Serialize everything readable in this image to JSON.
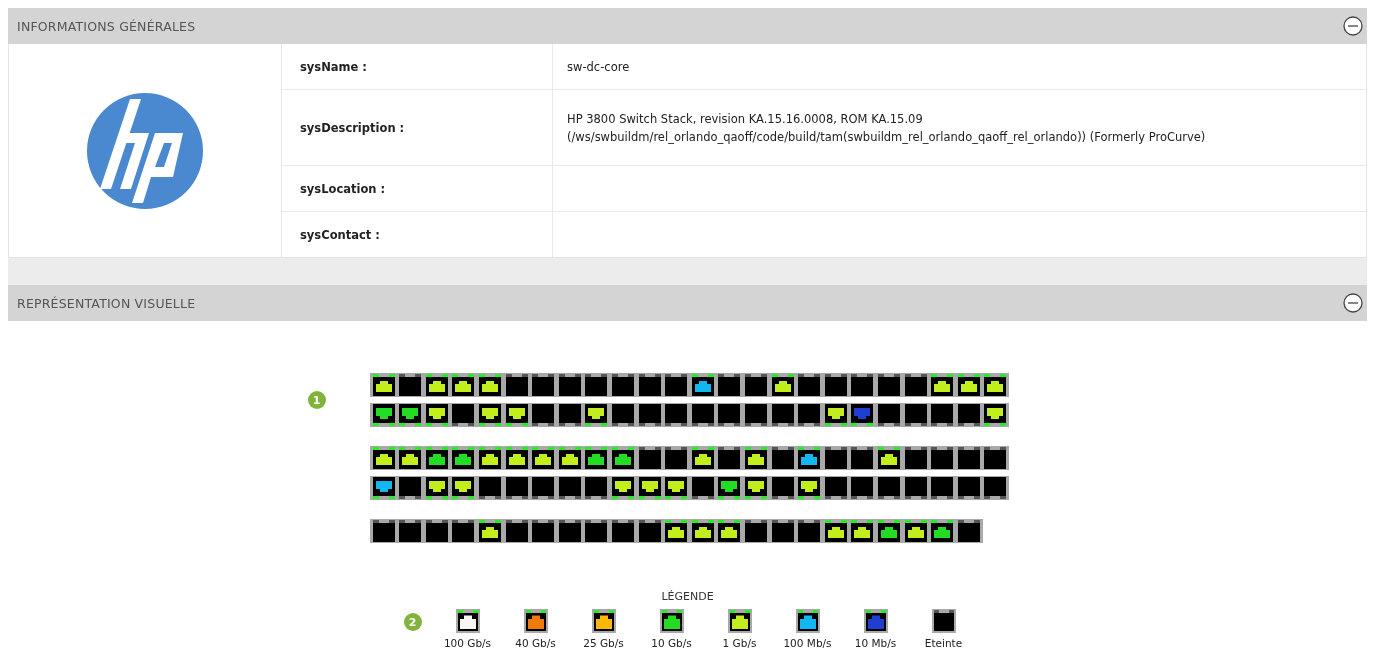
{
  "sections": [
    {
      "title": "INFORMATIONS GÉNÉRALES",
      "expanded": true
    },
    {
      "title": "REPRÉSENTATION VISUELLE",
      "expanded": true
    }
  ],
  "general_info": {
    "fields": [
      {
        "label": "sysName :",
        "value": "sw-dc-core"
      },
      {
        "label": "sysDescription :",
        "value": "HP 3800 Switch Stack, revision KA.15.16.0008, ROM KA.15.09\n(/ws/swbuildm/rel_orlando_qaoff/code/build/tam(swbuildm_rel_orlando_qaoff_rel_orlando)) (Formerly ProCurve)"
      },
      {
        "label": "sysLocation :"
      },
      {
        "label": "sysContact :"
      }
    ]
  },
  "visual": {
    "stacks": [
      {
        "badge": "1",
        "rows": [
          {
            "kind": "up",
            "ports": [
              {
                "color": "#c3ee1e",
                "on": true
              },
              {
                "color": "#000000",
                "on": false
              },
              {
                "color": "#c3ee1e",
                "on": true
              },
              {
                "color": "#c3ee1e",
                "on": true
              },
              {
                "color": "#c3ee1e",
                "on": true
              },
              {
                "color": "#000000",
                "on": false
              },
              {
                "color": "#000000",
                "on": false
              },
              {
                "color": "#000000",
                "on": false
              },
              {
                "color": "#000000",
                "on": false
              },
              {
                "color": "#000000",
                "on": false
              },
              {
                "color": "#000000",
                "on": false
              },
              {
                "color": "#000000",
                "on": false
              },
              {
                "color": "#12b6f0",
                "on": true
              },
              {
                "color": "#000000",
                "on": false
              },
              {
                "color": "#000000",
                "on": false
              },
              {
                "color": "#c3ee1e",
                "on": true
              },
              {
                "color": "#000000",
                "on": false
              },
              {
                "color": "#000000",
                "on": false
              },
              {
                "color": "#000000",
                "on": false
              },
              {
                "color": "#000000",
                "on": false
              },
              {
                "color": "#000000",
                "on": false
              },
              {
                "color": "#c3ee1e",
                "on": true
              },
              {
                "color": "#c3ee1e",
                "on": true
              },
              {
                "color": "#c3ee1e",
                "on": true
              }
            ]
          },
          {
            "kind": "down",
            "ports": [
              {
                "color": "#22dd22",
                "on": true
              },
              {
                "color": "#22dd22",
                "on": true
              },
              {
                "color": "#c3ee1e",
                "on": true
              },
              {
                "color": "#000000",
                "on": false
              },
              {
                "color": "#c3ee1e",
                "on": true
              },
              {
                "color": "#c3ee1e",
                "on": true
              },
              {
                "color": "#000000",
                "on": false
              },
              {
                "color": "#000000",
                "on": false
              },
              {
                "color": "#c3ee1e",
                "on": true
              },
              {
                "color": "#000000",
                "on": false
              },
              {
                "color": "#000000",
                "on": false
              },
              {
                "color": "#000000",
                "on": false
              },
              {
                "color": "#000000",
                "on": false
              },
              {
                "color": "#000000",
                "on": false
              },
              {
                "color": "#000000",
                "on": false
              },
              {
                "color": "#000000",
                "on": false
              },
              {
                "color": "#000000",
                "on": false
              },
              {
                "color": "#c3ee1e",
                "on": true
              },
              {
                "color": "#1e3fd0",
                "on": true
              },
              {
                "color": "#000000",
                "on": false
              },
              {
                "color": "#000000",
                "on": false
              },
              {
                "color": "#000000",
                "on": false
              },
              {
                "color": "#000000",
                "on": false
              },
              {
                "color": "#c3ee1e",
                "on": true
              }
            ]
          }
        ]
      },
      {
        "rows": [
          {
            "kind": "up",
            "ports": [
              {
                "color": "#c3ee1e",
                "on": true
              },
              {
                "color": "#c3ee1e",
                "on": true
              },
              {
                "color": "#22dd22",
                "on": true
              },
              {
                "color": "#22dd22",
                "on": true
              },
              {
                "color": "#c3ee1e",
                "on": true
              },
              {
                "color": "#c3ee1e",
                "on": true
              },
              {
                "color": "#c3ee1e",
                "on": true
              },
              {
                "color": "#c3ee1e",
                "on": true
              },
              {
                "color": "#22dd22",
                "on": true
              },
              {
                "color": "#22dd22",
                "on": true
              },
              {
                "color": "#000000",
                "on": false
              },
              {
                "color": "#000000",
                "on": false
              },
              {
                "color": "#c3ee1e",
                "on": true
              },
              {
                "color": "#000000",
                "on": false
              },
              {
                "color": "#c3ee1e",
                "on": true
              },
              {
                "color": "#000000",
                "on": false
              },
              {
                "color": "#12b6f0",
                "on": true
              },
              {
                "color": "#000000",
                "on": false
              },
              {
                "color": "#000000",
                "on": false
              },
              {
                "color": "#c3ee1e",
                "on": true
              },
              {
                "color": "#000000",
                "on": false
              },
              {
                "color": "#000000",
                "on": false
              },
              {
                "color": "#000000",
                "on": false
              },
              {
                "color": "#000000",
                "on": false
              }
            ]
          },
          {
            "kind": "down",
            "ports": [
              {
                "color": "#12b6f0",
                "on": true
              },
              {
                "color": "#000000",
                "on": false
              },
              {
                "color": "#c3ee1e",
                "on": true
              },
              {
                "color": "#c3ee1e",
                "on": true
              },
              {
                "color": "#000000",
                "on": false
              },
              {
                "color": "#000000",
                "on": false
              },
              {
                "color": "#000000",
                "on": false
              },
              {
                "color": "#000000",
                "on": false
              },
              {
                "color": "#000000",
                "on": false
              },
              {
                "color": "#c3ee1e",
                "on": true
              },
              {
                "color": "#c3ee1e",
                "on": true
              },
              {
                "color": "#c3ee1e",
                "on": true
              },
              {
                "color": "#000000",
                "on": false
              },
              {
                "color": "#22dd22",
                "on": true
              },
              {
                "color": "#c3ee1e",
                "on": true
              },
              {
                "color": "#000000",
                "on": false
              },
              {
                "color": "#c3ee1e",
                "on": true
              },
              {
                "color": "#000000",
                "on": false
              },
              {
                "color": "#000000",
                "on": false
              },
              {
                "color": "#000000",
                "on": false
              },
              {
                "color": "#000000",
                "on": false
              },
              {
                "color": "#000000",
                "on": false
              },
              {
                "color": "#000000",
                "on": false
              },
              {
                "color": "#000000",
                "on": false
              }
            ]
          }
        ]
      },
      {
        "rows": [
          {
            "kind": "up",
            "ports": [
              {
                "color": "#000000",
                "on": false
              },
              {
                "color": "#000000",
                "on": false
              },
              {
                "color": "#000000",
                "on": false
              },
              {
                "color": "#000000",
                "on": false
              },
              {
                "color": "#c3ee1e",
                "on": true
              },
              {
                "color": "#000000",
                "on": false
              },
              {
                "color": "#000000",
                "on": false
              },
              {
                "color": "#000000",
                "on": false
              },
              {
                "color": "#000000",
                "on": false
              },
              {
                "color": "#000000",
                "on": false
              },
              {
                "color": "#000000",
                "on": false
              },
              {
                "color": "#c3ee1e",
                "on": true
              },
              {
                "color": "#c3ee1e",
                "on": true
              },
              {
                "color": "#c3ee1e",
                "on": true
              },
              {
                "color": "#000000",
                "on": false
              },
              {
                "color": "#000000",
                "on": false
              },
              {
                "color": "#000000",
                "on": false
              },
              {
                "color": "#c3ee1e",
                "on": true
              },
              {
                "color": "#c3ee1e",
                "on": true
              },
              {
                "color": "#22dd22",
                "on": true
              },
              {
                "color": "#c3ee1e",
                "on": true
              },
              {
                "color": "#22dd22",
                "on": true
              },
              {
                "color": "#000000",
                "on": false
              }
            ]
          }
        ]
      }
    ]
  },
  "legend": {
    "title": "LÉGENDE",
    "badge": "2",
    "items": [
      {
        "label": "100 Gb/s",
        "color": "#f6f6f6",
        "on": true
      },
      {
        "label": "40 Gb/s",
        "color": "#f07a0a",
        "on": true
      },
      {
        "label": "25 Gb/s",
        "color": "#ffb80a",
        "on": true
      },
      {
        "label": "10 Gb/s",
        "color": "#22dd22",
        "on": true
      },
      {
        "label": "1 Gb/s",
        "color": "#c3ee1e",
        "on": true
      },
      {
        "label": "100 Mb/s",
        "color": "#12b6f0",
        "on": true
      },
      {
        "label": "10 Mb/s",
        "color": "#1e3fd0",
        "on": true
      },
      {
        "label": "Eteinte",
        "color": "#000000",
        "on": false
      }
    ]
  }
}
